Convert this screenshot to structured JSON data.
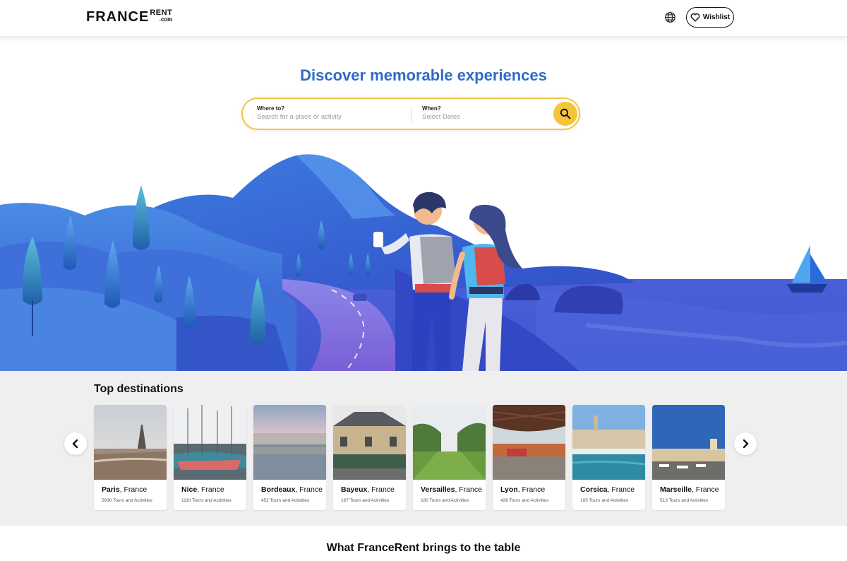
{
  "brand": {
    "name": "FRANCE",
    "suffix_top": "RENT",
    "suffix_bottom": ".com"
  },
  "header": {
    "wishlist_label": "Wishlist",
    "language_icon": "globe-icon"
  },
  "hero": {
    "title": "Discover memorable experiences",
    "search": {
      "where_label": "Where to?",
      "where_placeholder": "Search for a place or activity",
      "when_label": "When?",
      "when_placeholder": "Select Dates",
      "button_icon": "search-icon"
    }
  },
  "destinations": {
    "title": "Top destinations",
    "items": [
      {
        "city": "Paris",
        "country": ", France",
        "meta": "5930 Tours and Activities"
      },
      {
        "city": "Nice",
        "country": ", France",
        "meta": "1110 Tours and Activities"
      },
      {
        "city": "Bordeaux",
        "country": ", France",
        "meta": "452 Tours and Activities"
      },
      {
        "city": "Bayeux",
        "country": ", France",
        "meta": "167 Tours and Activities"
      },
      {
        "city": "Versailles",
        "country": ", France",
        "meta": "180 Tours and Activities"
      },
      {
        "city": "Lyon",
        "country": ", France",
        "meta": "426 Tours and Activities"
      },
      {
        "city": "Corsica",
        "country": ", France",
        "meta": "105 Tours and Activities"
      },
      {
        "city": "Marseille",
        "country": ", France",
        "meta": "513 Tours and Activities"
      }
    ]
  },
  "section2": {
    "title": "What FranceRent brings to the table"
  },
  "colors": {
    "accent_blue": "#2f6bc4",
    "search_yellow": "#f5c43a",
    "search_border": "#f2c840"
  }
}
